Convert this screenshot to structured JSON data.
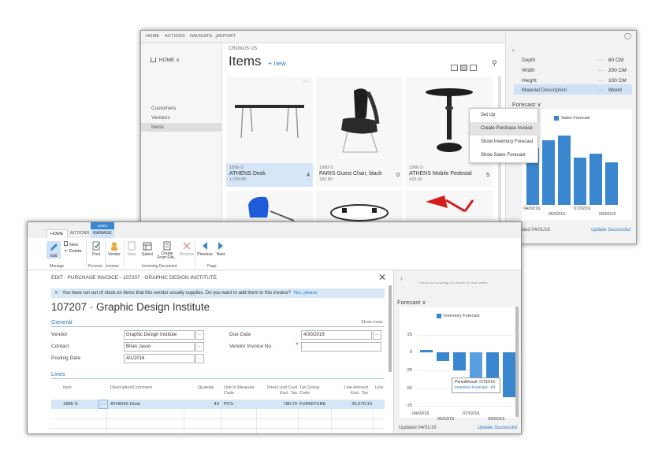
{
  "back_window": {
    "menu": [
      "HOME",
      "ACTIONS",
      "NAVIGATE",
      "REPORT"
    ],
    "nav": {
      "home_label": "HOME ∨",
      "items": [
        "Customers",
        "Vendors",
        "Items"
      ],
      "selected": "Items"
    },
    "breadcrumb": "CRONUS US",
    "title": "Items",
    "new_label": "+ new",
    "cards": [
      {
        "code": "1896-S",
        "name": "ATHENS Desk",
        "price": "1,000.80",
        "qty": "4",
        "selected": true
      },
      {
        "code": "1900-S",
        "name": "PARIS Guest Chair, black",
        "price": "192.80",
        "qty": "0",
        "selected": false
      },
      {
        "code": "1906-S",
        "name": "ATHENS Mobile Pedestal",
        "price": "433.60",
        "qty": "5",
        "selected": false
      }
    ],
    "factbox": {
      "properties": [
        {
          "label": "Depth",
          "value": "60 CM"
        },
        {
          "label": "Width",
          "value": "200 CM"
        },
        {
          "label": "Height",
          "value": "100 CM"
        },
        {
          "label": "Material Description",
          "value": "Wood"
        }
      ],
      "more_dots": "···",
      "forecast_label": "Forecast ∨",
      "updated": "Updated 04/01/16",
      "update_status": "Update Successful"
    },
    "context_menu": [
      "Set Up",
      "Create Purchase Invoice",
      "Show Inventory Forecast",
      "Show Sales Forecast"
    ],
    "context_selected": "Create Purchase Invoice"
  },
  "back_chart": {
    "type": "bar",
    "title": "Sales Forecast",
    "series": [
      {
        "name": "Sales Forecast",
        "values": [
          72,
          82,
          88,
          60,
          65,
          54
        ]
      }
    ],
    "x_tick_labels": [
      "04/02/16",
      "06/02/16",
      "07/02/16",
      "09/02/16"
    ],
    "ylim": [
      0,
      100
    ],
    "color": "#3a86cf"
  },
  "front_window": {
    "tabs": [
      "HOME",
      "ACTIONS",
      "MANAGE"
    ],
    "lines_context": "LINES",
    "ribbon": {
      "edit": "Edit",
      "new": "New",
      "delete": "Delete",
      "post": "Post",
      "vendor": "Vendor",
      "view": "View",
      "select": "Select",
      "create_from_file": "Create From File...",
      "remove": "Remove",
      "previous": "Previous",
      "next": "Next",
      "groups": [
        "Manage",
        "Process",
        "Invoice",
        "Incoming Document",
        "Page"
      ]
    },
    "page_header": "EDIT - PURCHASE INVOICE - 107207 · GRAPHIC DESIGN INSTITUTE",
    "notice": "You have run out of stock on items that this vendor usually supplies. Do you want to add them to this invoice?",
    "notice_link": "Yes, please",
    "doc_title": "107207 · Graphic Design Institute",
    "general_label": "General",
    "show_more": "Show more",
    "fields": {
      "vendor_label": "Vendor",
      "vendor": "Graphic Design Institute",
      "contact_label": "Contact",
      "contact": "Brian Jasso",
      "posting_date_label": "Posting Date",
      "posting_date": "4/1/2016",
      "due_date_label": "Due Date",
      "due_date": "4/30/2016",
      "vendor_invoice_label": "Vendor Invoice No.",
      "vendor_invoice": ""
    },
    "lines_label": "Lines",
    "columns": [
      "Item",
      "Description/Comment",
      "Quantity",
      "Unit of Measure Code",
      "Direct Unit Cost Excl. Tax",
      "Tax Group Code",
      "Line Amount Excl. Tax",
      "Line"
    ],
    "row": {
      "item": "1896-S",
      "dots": "···",
      "description": "ATHENS Desk",
      "quantity": "43",
      "uom": "PCS",
      "cost": "780.70",
      "tax_group": "FURNITURE",
      "amount": "33,570.10"
    },
    "factbox": {
      "cut_text": "There is nothing to show in this view",
      "forecast_label": "Forecast ∨",
      "updated": "Updated 04/01/16",
      "update_status": "Update Successful"
    },
    "tooltip": {
      "line1": "PeriodResult: 07/02/16",
      "line2": "Inventory Forecast: -43"
    }
  },
  "front_chart": {
    "type": "bar",
    "title": "Inventory Forecast",
    "series": [
      {
        "name": "Inventory Forecast",
        "values": [
          4,
          -12,
          -25,
          -43,
          -50,
          -62
        ]
      }
    ],
    "y_ticks": [
      25,
      0,
      -25,
      -50,
      -75
    ],
    "ylim": [
      -80,
      30
    ],
    "x_tick_labels": [
      "04/02/16",
      "06/02/16",
      "07/02/16",
      "09/02/16"
    ],
    "color": "#3a86cf"
  }
}
